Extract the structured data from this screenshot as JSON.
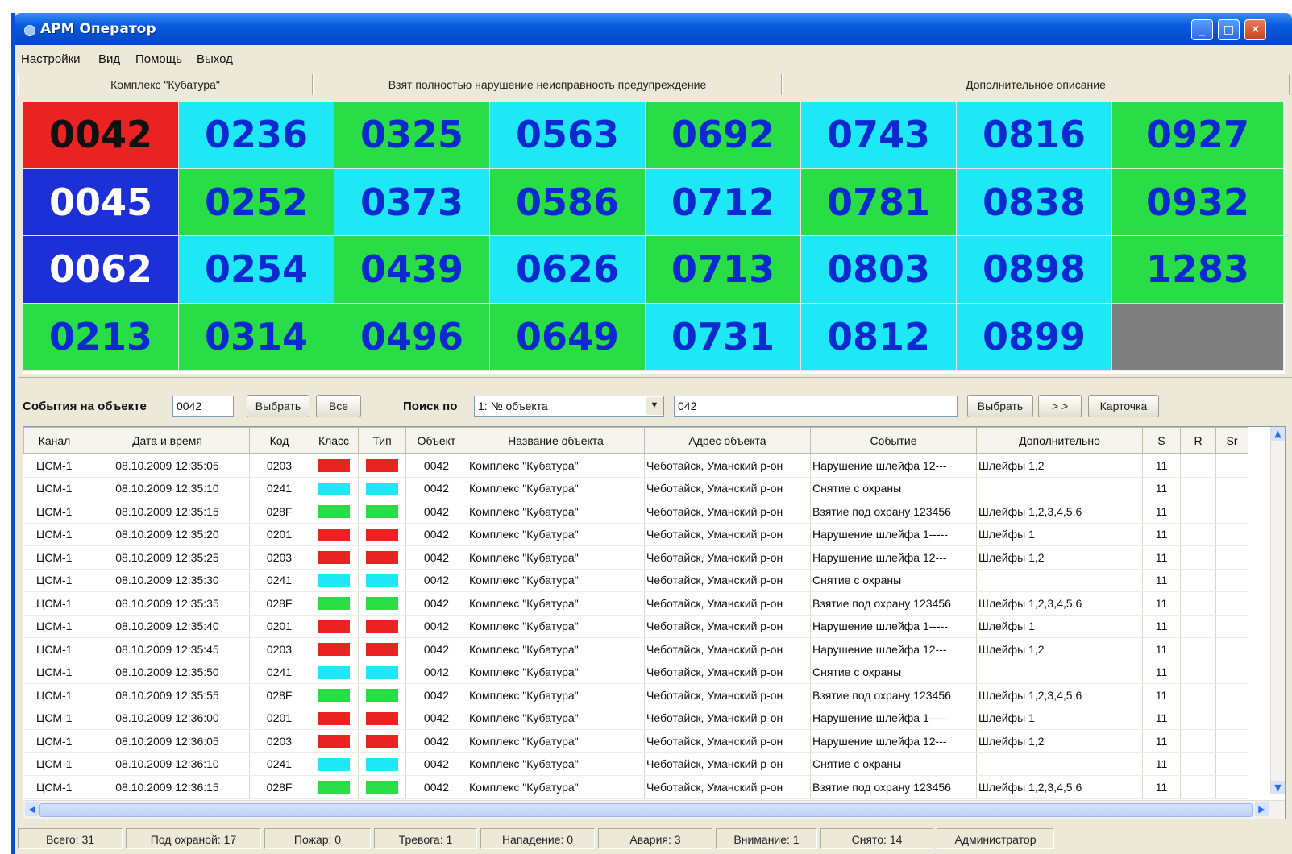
{
  "window": {
    "title": "АРМ Оператор",
    "controls": {
      "minimize": "_",
      "maximize": "□",
      "close": "✕"
    }
  },
  "menu": [
    "Настройки",
    "Вид",
    "Помощь",
    "Выход"
  ],
  "legend": {
    "object_name": "Комплекс \"Кубатура\"",
    "states": "Взят полностью  нарушение  неисправность  предупреждение",
    "extra": "Дополнительное описание"
  },
  "colors": {
    "red": "#ea2222",
    "blue": "#1d2fd6",
    "green": "#28dd46",
    "cyan": "#1ee8f5",
    "gray": "#7f7f7f",
    "tile_text": "#0d2ad1"
  },
  "tiles": [
    [
      "0042",
      "red"
    ],
    [
      "0236",
      "cyan"
    ],
    [
      "0325",
      "green"
    ],
    [
      "0563",
      "cyan"
    ],
    [
      "0692",
      "green"
    ],
    [
      "0743",
      "cyan"
    ],
    [
      "0816",
      "cyan"
    ],
    [
      "0927",
      "green"
    ],
    [
      "0045",
      "blue"
    ],
    [
      "0252",
      "green"
    ],
    [
      "0373",
      "cyan"
    ],
    [
      "0586",
      "green"
    ],
    [
      "0712",
      "cyan"
    ],
    [
      "0781",
      "green"
    ],
    [
      "0838",
      "cyan"
    ],
    [
      "0932",
      "green"
    ],
    [
      "0062",
      "blue"
    ],
    [
      "0254",
      "cyan"
    ],
    [
      "0439",
      "green"
    ],
    [
      "0626",
      "cyan"
    ],
    [
      "0713",
      "green"
    ],
    [
      "0803",
      "cyan"
    ],
    [
      "0898",
      "cyan"
    ],
    [
      "1283",
      "green"
    ],
    [
      "0213",
      "green"
    ],
    [
      "0314",
      "green"
    ],
    [
      "0496",
      "green"
    ],
    [
      "0649",
      "green"
    ],
    [
      "0731",
      "cyan"
    ],
    [
      "0812",
      "cyan"
    ],
    [
      "0899",
      "cyan"
    ],
    [
      "",
      "gray"
    ]
  ],
  "toolbar": {
    "events_label": "События на объекте",
    "object_value": "0042",
    "select_label": "Выбрать",
    "all_label": "Все",
    "search_label": "Поиск по",
    "search_by": "1: № объекта",
    "search_value": "042",
    "select2_label": "Выбрать",
    "next_label": "> >",
    "card_label": "Карточка"
  },
  "table": {
    "columns": [
      "Канал",
      "Дата и время",
      "Код",
      "Класс",
      "Тип",
      "Объект",
      "Название объекта",
      "Адрес объекта",
      "Событие",
      "Дополнительно",
      "S",
      "R",
      "Sr"
    ],
    "rows": [
      [
        "ЦСМ-1",
        "08.10.2009 12:35:05",
        "0203",
        "red",
        "red",
        "0042",
        "Комплекс \"Кубатура\"",
        "Чеботайск, Уманский р-он",
        "Нарушение шлейфа 12---",
        "Шлейфы 1,2",
        "11",
        "",
        ""
      ],
      [
        "ЦСМ-1",
        "08.10.2009 12:35:10",
        "0241",
        "cyan",
        "cyan",
        "0042",
        "Комплекс \"Кубатура\"",
        "Чеботайск, Уманский р-он",
        "Снятие с охраны",
        "",
        "11",
        "",
        ""
      ],
      [
        "ЦСМ-1",
        "08.10.2009 12:35:15",
        "028F",
        "green",
        "green",
        "0042",
        "Комплекс \"Кубатура\"",
        "Чеботайск, Уманский р-он",
        "Взятие под охрану 123456",
        "Шлейфы 1,2,3,4,5,6",
        "11",
        "",
        ""
      ],
      [
        "ЦСМ-1",
        "08.10.2009 12:35:20",
        "0201",
        "red",
        "red",
        "0042",
        "Комплекс \"Кубатура\"",
        "Чеботайск, Уманский р-он",
        "Нарушение шлейфа 1-----",
        "Шлейфы 1",
        "11",
        "",
        ""
      ],
      [
        "ЦСМ-1",
        "08.10.2009 12:35:25",
        "0203",
        "red",
        "red",
        "0042",
        "Комплекс \"Кубатура\"",
        "Чеботайск, Уманский р-он",
        "Нарушение шлейфа 12---",
        "Шлейфы 1,2",
        "11",
        "",
        ""
      ],
      [
        "ЦСМ-1",
        "08.10.2009 12:35:30",
        "0241",
        "cyan",
        "cyan",
        "0042",
        "Комплекс \"Кубатура\"",
        "Чеботайск, Уманский р-он",
        "Снятие с охраны",
        "",
        "11",
        "",
        ""
      ],
      [
        "ЦСМ-1",
        "08.10.2009 12:35:35",
        "028F",
        "green",
        "green",
        "0042",
        "Комплекс \"Кубатура\"",
        "Чеботайск, Уманский р-он",
        "Взятие под охрану 123456",
        "Шлейфы 1,2,3,4,5,6",
        "11",
        "",
        ""
      ],
      [
        "ЦСМ-1",
        "08.10.2009 12:35:40",
        "0201",
        "red",
        "red",
        "0042",
        "Комплекс \"Кубатура\"",
        "Чеботайск, Уманский р-он",
        "Нарушение шлейфа 1-----",
        "Шлейфы 1",
        "11",
        "",
        ""
      ],
      [
        "ЦСМ-1",
        "08.10.2009 12:35:45",
        "0203",
        "red",
        "red",
        "0042",
        "Комплекс \"Кубатура\"",
        "Чеботайск, Уманский р-он",
        "Нарушение шлейфа 12---",
        "Шлейфы 1,2",
        "11",
        "",
        ""
      ],
      [
        "ЦСМ-1",
        "08.10.2009 12:35:50",
        "0241",
        "cyan",
        "cyan",
        "0042",
        "Комплекс \"Кубатура\"",
        "Чеботайск, Уманский р-он",
        "Снятие с охраны",
        "",
        "11",
        "",
        ""
      ],
      [
        "ЦСМ-1",
        "08.10.2009 12:35:55",
        "028F",
        "green",
        "green",
        "0042",
        "Комплекс \"Кубатура\"",
        "Чеботайск, Уманский р-он",
        "Взятие под охрану 123456",
        "Шлейфы 1,2,3,4,5,6",
        "11",
        "",
        ""
      ],
      [
        "ЦСМ-1",
        "08.10.2009 12:36:00",
        "0201",
        "red",
        "red",
        "0042",
        "Комплекс \"Кубатура\"",
        "Чеботайск, Уманский р-он",
        "Нарушение шлейфа 1-----",
        "Шлейфы 1",
        "11",
        "",
        ""
      ],
      [
        "ЦСМ-1",
        "08.10.2009 12:36:05",
        "0203",
        "red",
        "red",
        "0042",
        "Комплекс \"Кубатура\"",
        "Чеботайск, Уманский р-он",
        "Нарушение шлейфа 12---",
        "Шлейфы 1,2",
        "11",
        "",
        ""
      ],
      [
        "ЦСМ-1",
        "08.10.2009 12:36:10",
        "0241",
        "cyan",
        "cyan",
        "0042",
        "Комплекс \"Кубатура\"",
        "Чеботайск, Уманский р-он",
        "Снятие с охраны",
        "",
        "11",
        "",
        ""
      ],
      [
        "ЦСМ-1",
        "08.10.2009 12:36:15",
        "028F",
        "green",
        "green",
        "0042",
        "Комплекс \"Кубатура\"",
        "Чеботайск, Уманский р-он",
        "Взятие под охрану 123456",
        "Шлейфы 1,2,3,4,5,6",
        "11",
        "",
        ""
      ]
    ]
  },
  "status": [
    "Всего: 31",
    "Под охраной: 17",
    "Пожар: 0",
    "Тревога: 1",
    "Нападение: 0",
    "Авария: 3",
    "Внимание: 1",
    "Снято: 14",
    "Администратор"
  ]
}
